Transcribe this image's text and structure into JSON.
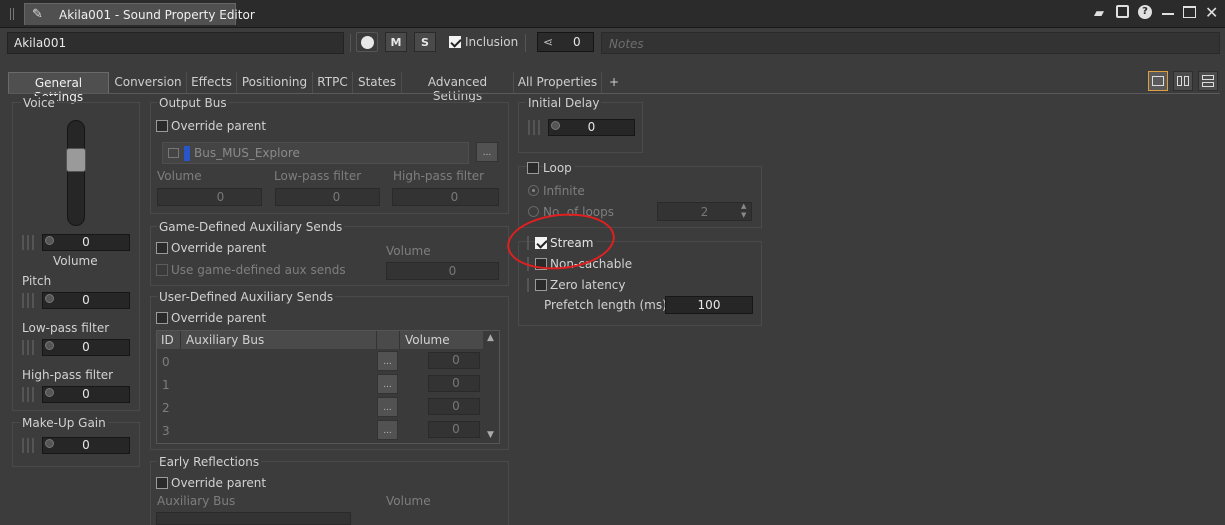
{
  "window": {
    "title": "Akila001 - Sound Property Editor"
  },
  "header": {
    "name_value": "Akila001",
    "m_label": "M",
    "s_label": "S",
    "inclusion_label": "Inclusion",
    "inclusion_checked": true,
    "refs_count": "0",
    "notes_placeholder": "Notes"
  },
  "tabs": [
    "General Settings",
    "Conversion",
    "Effects",
    "Positioning",
    "RTPC",
    "States",
    "Advanced Settings",
    "All Properties",
    "+"
  ],
  "voice": {
    "title": "Voice",
    "volume_value": "0",
    "volume_label": "Volume",
    "pitch_label": "Pitch",
    "pitch_value": "0",
    "lpf_label": "Low-pass filter",
    "lpf_value": "0",
    "hpf_label": "High-pass filter",
    "hpf_value": "0"
  },
  "makeup": {
    "title": "Make-Up Gain",
    "value": "0"
  },
  "output_bus": {
    "title": "Output Bus",
    "override_label": "Override parent",
    "bus_name": "Bus_MUS_Explore",
    "ellipsis": "...",
    "volume_label": "Volume",
    "volume_value": "0",
    "lpf_label": "Low-pass filter",
    "lpf_value": "0",
    "hpf_label": "High-pass filter",
    "hpf_value": "0"
  },
  "game_aux": {
    "title": "Game-Defined Auxiliary Sends",
    "override_label": "Override parent",
    "use_label": "Use game-defined aux sends",
    "volume_label": "Volume",
    "volume_value": "0"
  },
  "user_aux": {
    "title": "User-Defined Auxiliary Sends",
    "override_label": "Override parent",
    "col_id": "ID",
    "col_bus": "Auxiliary Bus",
    "col_volume": "Volume",
    "rows": [
      {
        "id": "0",
        "value": "0"
      },
      {
        "id": "1",
        "value": "0"
      },
      {
        "id": "2",
        "value": "0"
      },
      {
        "id": "3",
        "value": "0"
      }
    ],
    "ellipsis": "..."
  },
  "early": {
    "title": "Early Reflections",
    "override_label": "Override parent",
    "aux_label": "Auxiliary Bus",
    "volume_label": "Volume"
  },
  "initial_delay": {
    "title": "Initial Delay",
    "value": "0"
  },
  "loop": {
    "label": "Loop",
    "infinite_label": "Infinite",
    "noloops_label": "No. of loops",
    "noloops_value": "2"
  },
  "stream": {
    "label": "Stream",
    "checked": true,
    "noncachable_label": "Non-cachable",
    "zerolat_label": "Zero latency",
    "prefetch_label": "Prefetch length (ms)",
    "prefetch_value": "100"
  }
}
